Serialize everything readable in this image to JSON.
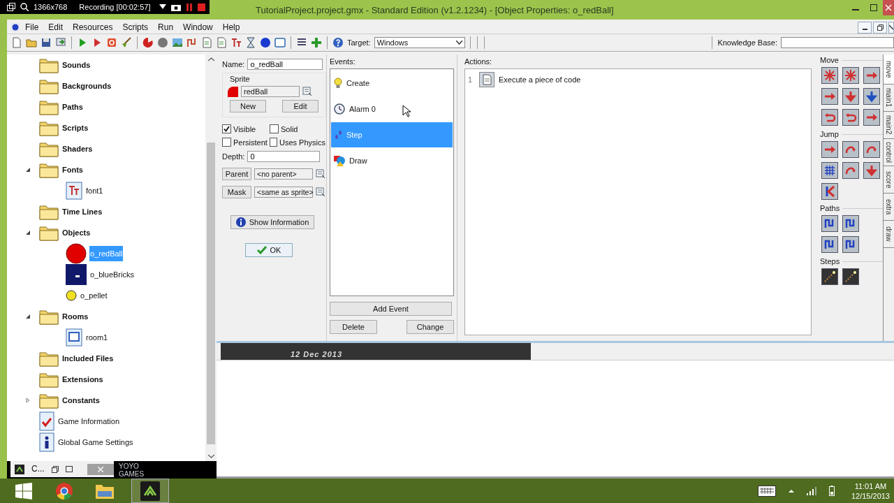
{
  "recorder": {
    "resolution": "1366x768",
    "status": "Recording [00:02:57]"
  },
  "window": {
    "title": "TutorialProject.project.gmx - Standard Edition (v1.2.1234) - [Object Properties: o_redBall]"
  },
  "menu": [
    "File",
    "Edit",
    "Resources",
    "Scripts",
    "Run",
    "Window",
    "Help"
  ],
  "toolbar": {
    "target_label": "Target:",
    "target_value": "Windows",
    "knowledge_label": "Knowledge Base:"
  },
  "tree": [
    {
      "label": "Sounds",
      "kind": "folder",
      "selected": false
    },
    {
      "label": "Backgrounds",
      "kind": "folder",
      "selected": false
    },
    {
      "label": "Paths",
      "kind": "folder",
      "selected": false
    },
    {
      "label": "Scripts",
      "kind": "folder",
      "selected": false
    },
    {
      "label": "Shaders",
      "kind": "folder",
      "selected": false
    },
    {
      "label": "Fonts",
      "kind": "folder",
      "selected": false,
      "expanded": true,
      "children": [
        {
          "label": "font1",
          "kind": "font",
          "selected": false
        }
      ]
    },
    {
      "label": "Time Lines",
      "kind": "folder",
      "selected": false
    },
    {
      "label": "Objects",
      "kind": "folder",
      "selected": false,
      "expanded": true,
      "children": [
        {
          "label": "o_redBall",
          "kind": "ball",
          "selected": true
        },
        {
          "label": "o_blueBricks",
          "kind": "brick",
          "selected": false
        },
        {
          "label": "o_pellet",
          "kind": "pellet",
          "selected": false
        }
      ]
    },
    {
      "label": "Rooms",
      "kind": "folder",
      "selected": false,
      "expanded": true,
      "children": [
        {
          "label": "room1",
          "kind": "room",
          "selected": false
        }
      ]
    },
    {
      "label": "Included Files",
      "kind": "folder",
      "selected": false
    },
    {
      "label": "Extensions",
      "kind": "folder",
      "selected": false
    },
    {
      "label": "Constants",
      "kind": "folder",
      "selected": false,
      "expanded": false
    },
    {
      "label": "Game Information",
      "kind": "game-info",
      "selected": false
    },
    {
      "label": "Global Game Settings",
      "kind": "game-settings",
      "selected": false
    }
  ],
  "object": {
    "name_label": "Name:",
    "name": "o_redBall",
    "sprite_label": "Sprite",
    "sprite": "redBall",
    "sprite_buttons": [
      "New",
      "Edit"
    ],
    "checkboxes": [
      {
        "label": "Visible",
        "checked": true
      },
      {
        "label": "Solid",
        "checked": false
      },
      {
        "label": "Persistent",
        "checked": false
      },
      {
        "label": "Uses Physics",
        "checked": false
      }
    ],
    "depth_label": "Depth:",
    "depth": "0",
    "parent_button": "Parent",
    "parent": "<no parent>",
    "mask_button": "Mask",
    "mask": "<same as sprite>",
    "info_button": "Show Information",
    "ok_button": "OK"
  },
  "events": {
    "label": "Events:",
    "items": [
      {
        "label": "Create",
        "kind": "create",
        "selected": false
      },
      {
        "label": "Alarm 0",
        "kind": "alarm",
        "selected": false
      },
      {
        "label": "Step",
        "kind": "step",
        "selected": true
      },
      {
        "label": "Draw",
        "kind": "draw",
        "selected": false
      }
    ],
    "add_button": "Add Event",
    "delete_button": "Delete",
    "change_button": "Change"
  },
  "actions": {
    "label": "Actions:",
    "items": [
      {
        "number": "1",
        "label": "Execute a piece of code"
      }
    ]
  },
  "palette": {
    "groups": [
      "Move",
      "Jump",
      "Paths",
      "Steps"
    ],
    "tabs": [
      {
        "label": "move",
        "selected": true
      },
      {
        "label": "main1",
        "selected": false
      },
      {
        "label": "main2",
        "selected": false
      },
      {
        "label": "control",
        "selected": false
      },
      {
        "label": "score",
        "selected": false
      },
      {
        "label": "extra",
        "selected": false
      },
      {
        "label": "draw",
        "selected": false
      }
    ]
  },
  "strip": {
    "date": "12 Dec 2013"
  },
  "minimized_window": {
    "title": "C..."
  },
  "logo": [
    "YOYO",
    "GAMES"
  ],
  "taskbar": {
    "time": "11:01 AM",
    "date": "12/15/2013"
  }
}
